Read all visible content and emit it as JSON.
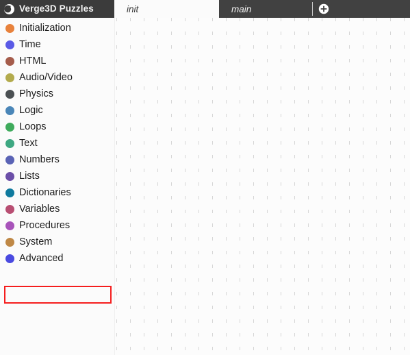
{
  "window": {
    "title": "Verge3D Puzzles"
  },
  "topbar": {
    "brand": {
      "logo_icon": "verge3d-puzzles-logo-icon",
      "title": "Verge3D Puzzles"
    },
    "tabs": [
      {
        "label": "init",
        "active": true
      },
      {
        "label": "main",
        "active": false
      }
    ],
    "add_tab": {
      "icon": "plus-circle-icon",
      "label": "+"
    }
  },
  "sidebar": {
    "items": [
      {
        "label": "Initialization",
        "color": "#e8823c",
        "icon": "category-dot-icon"
      },
      {
        "label": "Time",
        "color": "#5a5ae6",
        "icon": "category-dot-icon"
      },
      {
        "label": "HTML",
        "color": "#a55c4b",
        "icon": "category-dot-icon"
      },
      {
        "label": "Audio/Video",
        "color": "#b3ab4d",
        "icon": "category-dot-icon"
      },
      {
        "label": "Physics",
        "color": "#4b5053",
        "icon": "category-dot-icon"
      },
      {
        "label": "Logic",
        "color": "#4a86b8",
        "icon": "category-dot-icon"
      },
      {
        "label": "Loops",
        "color": "#3fab5c",
        "icon": "category-dot-icon"
      },
      {
        "label": "Text",
        "color": "#3ea882",
        "icon": "category-dot-icon"
      },
      {
        "label": "Numbers",
        "color": "#5a63b5",
        "icon": "category-dot-icon"
      },
      {
        "label": "Lists",
        "color": "#6b4fa8",
        "icon": "category-dot-icon"
      },
      {
        "label": "Dictionaries",
        "color": "#0f7a9e",
        "icon": "category-dot-icon"
      },
      {
        "label": "Variables",
        "color": "#b84e72",
        "icon": "category-dot-icon"
      },
      {
        "label": "Procedures",
        "color": "#a854ba",
        "icon": "category-dot-icon"
      },
      {
        "label": "System",
        "color": "#bf8846",
        "icon": "category-dot-icon"
      },
      {
        "label": "Advanced",
        "color": "#4a4ae0",
        "icon": "category-dot-icon"
      }
    ]
  },
  "annotation": {
    "name": "red-highlight-box",
    "color": "#f51d1d",
    "text": ""
  },
  "workspace": {
    "background": "#fcfcfc",
    "grid_color": "#d6d6d6",
    "grid_spacing": 20,
    "blocks": []
  }
}
